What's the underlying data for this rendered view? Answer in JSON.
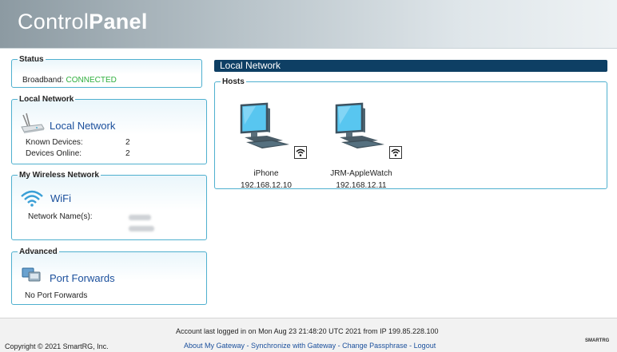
{
  "header": {
    "logo_part1": "Control",
    "logo_part2": "Panel"
  },
  "status": {
    "legend": "Status",
    "broadband_label": "Broadband:",
    "broadband_value": "CONNECTED",
    "status_color": "#2eaf3d"
  },
  "local_network_panel": {
    "legend": "Local Network",
    "title": "Local Network",
    "icon": "router-icon",
    "known_devices_label": "Known Devices:",
    "known_devices_value": "2",
    "devices_online_label": "Devices Online:",
    "devices_online_value": "2"
  },
  "wireless": {
    "legend": "My Wireless Network",
    "title": "WiFi",
    "icon": "wifi-icon",
    "network_names_label": "Network Name(s):"
  },
  "advanced": {
    "legend": "Advanced",
    "title": "Port Forwards",
    "icon": "port-forward-icon",
    "status": "No Port Forwards"
  },
  "main": {
    "title": "Local Network",
    "hosts_legend": "Hosts",
    "hosts": [
      {
        "name": "iPhone",
        "ip": "192.168.12.10",
        "icon": "computer-icon",
        "badge": "wifi-icon"
      },
      {
        "name": "JRM-AppleWatch",
        "ip": "192.168.12.11",
        "icon": "computer-icon",
        "badge": "wifi-icon"
      }
    ]
  },
  "footer": {
    "copyright": "Copyright © 2021 SmartRG, Inc.",
    "account": "Account last logged in on Mon Aug 23 21:48:20 UTC 2021 from IP 199.85.228.100",
    "links": [
      "About My Gateway",
      "Synchronize with Gateway",
      "Change Passphrase",
      "Logout"
    ],
    "separator": " - ",
    "brand": "SMARTRG"
  },
  "colors": {
    "accent": "#1a4f9c",
    "panel_border": "#4fb0cf",
    "titlebar": "#0e3f64"
  }
}
